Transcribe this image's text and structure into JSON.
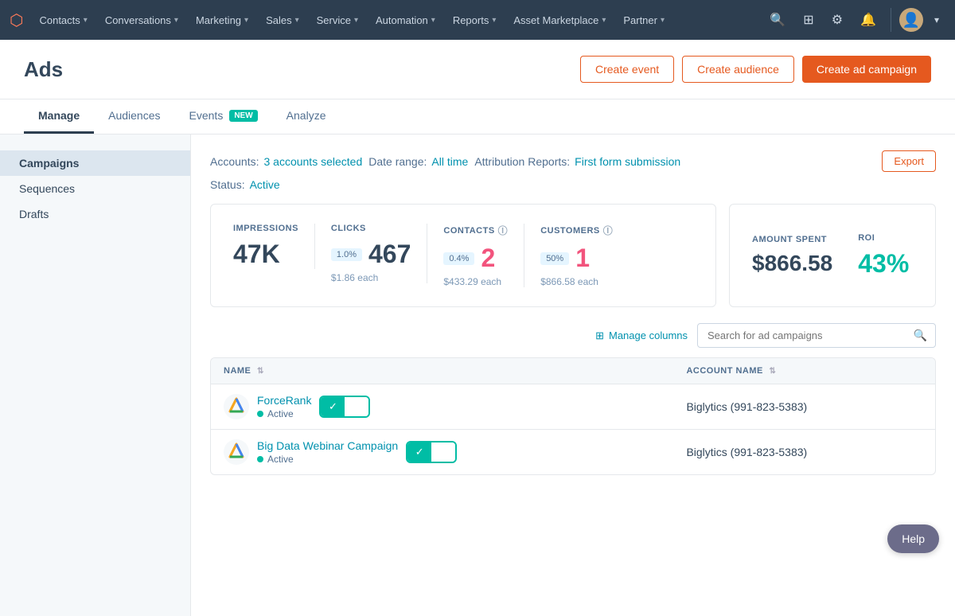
{
  "nav": {
    "logo": "⬡",
    "items": [
      {
        "label": "Contacts",
        "id": "contacts"
      },
      {
        "label": "Conversations",
        "id": "conversations"
      },
      {
        "label": "Marketing",
        "id": "marketing"
      },
      {
        "label": "Sales",
        "id": "sales"
      },
      {
        "label": "Service",
        "id": "service"
      },
      {
        "label": "Automation",
        "id": "automation"
      },
      {
        "label": "Reports",
        "id": "reports"
      },
      {
        "label": "Asset Marketplace",
        "id": "asset-marketplace"
      },
      {
        "label": "Partner",
        "id": "partner"
      }
    ]
  },
  "page": {
    "title": "Ads",
    "buttons": {
      "create_event": "Create event",
      "create_audience": "Create audience",
      "create_campaign": "Create ad campaign"
    }
  },
  "tabs": [
    {
      "label": "Manage",
      "id": "manage",
      "active": true,
      "badge": null
    },
    {
      "label": "Audiences",
      "id": "audiences",
      "active": false,
      "badge": null
    },
    {
      "label": "Events",
      "id": "events",
      "active": false,
      "badge": "NEW"
    },
    {
      "label": "Analyze",
      "id": "analyze",
      "active": false,
      "badge": null
    }
  ],
  "sidebar": {
    "items": [
      {
        "label": "Campaigns",
        "id": "campaigns",
        "active": true
      },
      {
        "label": "Sequences",
        "id": "sequences",
        "active": false
      },
      {
        "label": "Drafts",
        "id": "drafts",
        "active": false
      }
    ]
  },
  "filters": {
    "accounts_label": "Accounts:",
    "accounts_value": "3 accounts selected",
    "date_range_label": "Date range:",
    "date_range_value": "All time",
    "attribution_label": "Attribution Reports:",
    "attribution_value": "First form submission",
    "status_label": "Status:",
    "status_value": "Active",
    "export_btn": "Export"
  },
  "stats": {
    "impressions": {
      "label": "IMPRESSIONS",
      "value": "47K",
      "badge": null,
      "sub": null
    },
    "clicks": {
      "label": "CLICKS",
      "value": "467",
      "badge": "1.0%",
      "sub": "$1.86 each"
    },
    "contacts": {
      "label": "CONTACTS",
      "value": "2",
      "badge": "0.4%",
      "sub": "$433.29 each",
      "info": true
    },
    "customers": {
      "label": "CUSTOMERS",
      "value": "1",
      "badge": "50%",
      "sub": "$866.58 each",
      "info": true
    },
    "amount_spent": {
      "label": "AMOUNT SPENT",
      "value": "$866.58"
    },
    "roi": {
      "label": "ROI",
      "value": "43%"
    }
  },
  "toolbar": {
    "manage_columns": "Manage columns",
    "search_placeholder": "Search for ad campaigns"
  },
  "table": {
    "columns": [
      {
        "label": "NAME",
        "id": "name",
        "sortable": true
      },
      {
        "label": "ACCOUNT NAME",
        "id": "account_name",
        "sortable": true
      }
    ],
    "rows": [
      {
        "name": "ForceRank",
        "status": "Active",
        "status_active": true,
        "account": "Biglytics (991-823-5383)",
        "toggle_on": true
      },
      {
        "name": "Big Data Webinar Campaign",
        "status": "Active",
        "status_active": true,
        "account": "Biglytics (991-823-5383)",
        "toggle_on": true
      }
    ]
  },
  "help": {
    "label": "Help"
  }
}
